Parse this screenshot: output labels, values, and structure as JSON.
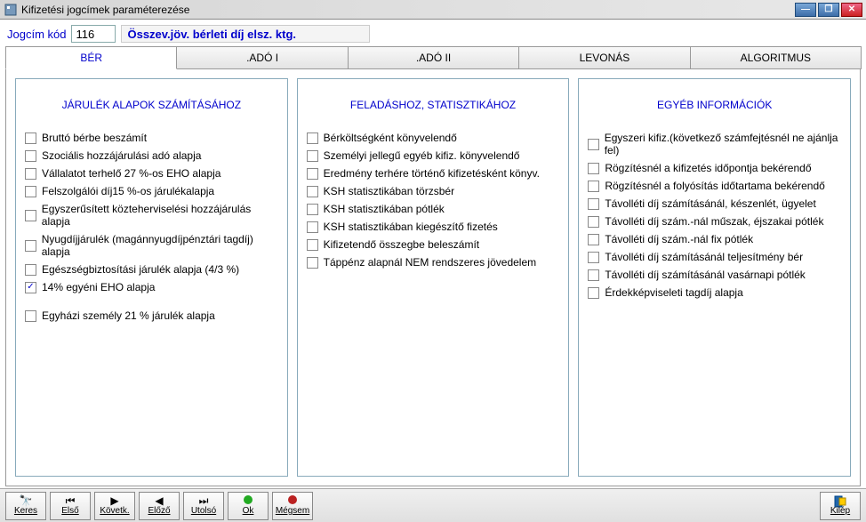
{
  "window": {
    "title": "Kifizetési jogcímek paraméterezése"
  },
  "header": {
    "code_label": "Jogcím kód",
    "code_value": "116",
    "description": "Összev.jöv. bérleti díj elsz. ktg."
  },
  "tabs": {
    "ber": "BÉR",
    "ado1": ".ADÓ I",
    "ado2": ".ADÓ II",
    "levonas": "LEVONÁS",
    "algoritmus": "ALGORITMUS"
  },
  "panels": {
    "left": {
      "title": "JÁRULÉK ALAPOK SZÁMÍTÁSÁHOZ",
      "items": [
        {
          "label": "Bruttó bérbe beszámít",
          "checked": false
        },
        {
          "label": "Szociális hozzájárulási adó alapja",
          "checked": false
        },
        {
          "label": "Vállalatot terhelő 27 %-os EHO alapja",
          "checked": false
        },
        {
          "label": "Felszolgálói díj15 %-os járulékalapja",
          "checked": false
        },
        {
          "label": "Egyszerűsített közteherviselési hozzájárulás alapja",
          "checked": false
        },
        {
          "label": "Nyugdíjjárulék (magánnyugdíjpénztári tagdíj) alapja",
          "checked": false
        },
        {
          "label": "Egészségbiztosítási járulék alapja (4/3 %)",
          "checked": false
        },
        {
          "label": "14% egyéni EHO alapja",
          "checked": true
        },
        {
          "label": "Egyházi személy 21 % járulék alapja",
          "checked": false,
          "gap": true
        }
      ]
    },
    "middle": {
      "title": "FELADÁSHOZ, STATISZTIKÁHOZ",
      "items": [
        {
          "label": "Bérköltségként könyvelendő",
          "checked": false
        },
        {
          "label": "Személyi jellegű egyéb kifiz. könyvelendő",
          "checked": false
        },
        {
          "label": "Eredmény terhére történő kifizetésként könyv.",
          "checked": false
        },
        {
          "label": "KSH statisztikában törzsbér",
          "checked": false
        },
        {
          "label": "KSH statisztikában pótlék",
          "checked": false
        },
        {
          "label": "KSH statisztikában kiegészítő fizetés",
          "checked": false
        },
        {
          "label": "Kifizetendő összegbe beleszámít",
          "checked": false
        },
        {
          "label": "Táppénz alapnál NEM rendszeres jövedelem",
          "checked": false
        }
      ]
    },
    "right": {
      "title": "EGYÉB INFORMÁCIÓK",
      "items": [
        {
          "label": "Egyszeri kifiz.(következő számfejtésnél ne ajánlja fel)",
          "checked": false
        },
        {
          "label": "Rögzítésnél a kifizetés időpontja bekérendő",
          "checked": false
        },
        {
          "label": "Rögzítésnél a folyósítás időtartama bekérendő",
          "checked": false
        },
        {
          "label": "Távolléti díj számításánál, készenlét, ügyelet",
          "checked": false
        },
        {
          "label": "Távolléti díj szám.-nál műszak, éjszakai pótlék",
          "checked": false
        },
        {
          "label": "Távolléti díj szám.-nál fix pótlék",
          "checked": false
        },
        {
          "label": "Távolléti díj számításánál teljesítmény bér",
          "checked": false
        },
        {
          "label": "Távolléti díj számításánál vasárnapi pótlék",
          "checked": false
        },
        {
          "label": "Érdekképviseleti tagdíj alapja",
          "checked": false
        }
      ]
    }
  },
  "toolbar": {
    "keres": "Keres",
    "elso": "Első",
    "kovetk": "Követk.",
    "elozo": "Előző",
    "utolso": "Utolsó",
    "ok": "Ok",
    "megsem": "Mégsem",
    "kilep": "Kilép"
  }
}
